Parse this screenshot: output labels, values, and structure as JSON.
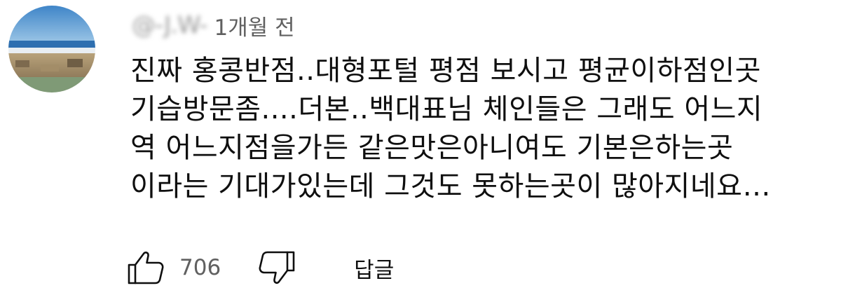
{
  "comment": {
    "author": "@-J.W-",
    "timestamp": "1개월 전",
    "text_lines": [
      "진짜 홍콩반점..대형포털 평점 보시고 평균이하점인곳",
      "기습방문좀....더본..백대표님 체인들은 그래도 어느지",
      "역 어느지점을가든 같은맛은아니여도 기본은하는곳",
      "이라는 기대가있는데 그것도 못하는곳이 많아지네요…"
    ]
  },
  "actions": {
    "like_icon": "thumbs-up-icon",
    "like_count": "706",
    "dislike_icon": "thumbs-down-icon",
    "reply_label": "답글"
  },
  "colors": {
    "text_primary": "#0f0f0f",
    "text_secondary": "#606060"
  }
}
